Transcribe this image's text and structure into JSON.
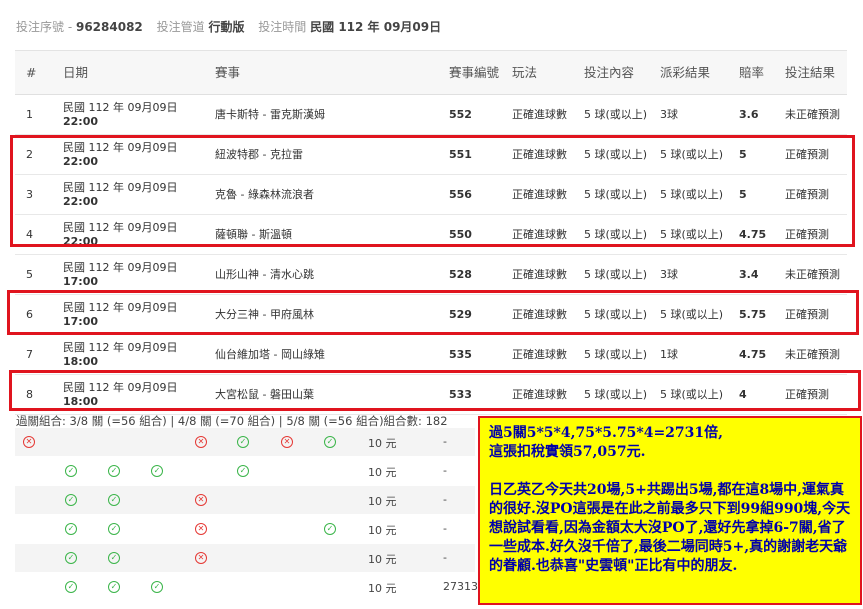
{
  "header": {
    "serial_label": "投注序號",
    "serial_value": "96284082",
    "channel_label": "投注管道",
    "channel_value": "行動版",
    "time_label": "投注時間",
    "time_value": "民國 112 年 09月09日"
  },
  "table": {
    "headers": [
      "#",
      "日期",
      "賽事",
      "賽事編號",
      "玩法",
      "投注內容",
      "派彩結果",
      "賠率",
      "投注結果"
    ],
    "rows": [
      {
        "n": "1",
        "date": "民國 112 年 09月09日",
        "time": "22:00",
        "match": "唐卡斯特 - 雷克斯漢姆",
        "id": "552",
        "play": "正確進球數",
        "bet": "5 球(或以上)",
        "payout": "3球",
        "odds": "3.6",
        "result": "未正確預測"
      },
      {
        "n": "2",
        "date": "民國 112 年 09月09日",
        "time": "22:00",
        "match": "紐波特郡 - 克拉雷",
        "id": "551",
        "play": "正確進球數",
        "bet": "5 球(或以上)",
        "payout": "5 球(或以上)",
        "odds": "5",
        "result": "正確預測"
      },
      {
        "n": "3",
        "date": "民國 112 年 09月09日",
        "time": "22:00",
        "match": "克魯 - 綠森林流浪者",
        "id": "556",
        "play": "正確進球數",
        "bet": "5 球(或以上)",
        "payout": "5 球(或以上)",
        "odds": "5",
        "result": "正確預測"
      },
      {
        "n": "4",
        "date": "民國 112 年 09月09日",
        "time": "22:00",
        "match": "薩頓聯 - 斯溫頓",
        "id": "550",
        "play": "正確進球數",
        "bet": "5 球(或以上)",
        "payout": "5 球(或以上)",
        "odds": "4.75",
        "result": "正確預測"
      },
      {
        "n": "5",
        "date": "民國 112 年 09月09日",
        "time": "17:00",
        "match": "山形山神 - 清水心跳",
        "id": "528",
        "play": "正確進球數",
        "bet": "5 球(或以上)",
        "payout": "3球",
        "odds": "3.4",
        "result": "未正確預測"
      },
      {
        "n": "6",
        "date": "民國 112 年 09月09日",
        "time": "17:00",
        "match": "大分三神 - 甲府風林",
        "id": "529",
        "play": "正確進球數",
        "bet": "5 球(或以上)",
        "payout": "5 球(或以上)",
        "odds": "5.75",
        "result": "正確預測"
      },
      {
        "n": "7",
        "date": "民國 112 年 09月09日",
        "time": "18:00",
        "match": "仙台維加塔 - 岡山綠雉",
        "id": "535",
        "play": "正確進球數",
        "bet": "5 球(或以上)",
        "payout": "1球",
        "odds": "4.75",
        "result": "未正確預測"
      },
      {
        "n": "8",
        "date": "民國 112 年 09月09日",
        "time": "18:00",
        "match": "大宮松鼠 - 磐田山葉",
        "id": "533",
        "play": "正確進球數",
        "bet": "5 球(或以上)",
        "payout": "5 球(或以上)",
        "odds": "4",
        "result": "正確預測"
      }
    ]
  },
  "summary": "過關組合: 3/8 關 (=56 組合) | 4/8 關 (=70 組合) | 5/8 關 (=56 組合)組合數: 182",
  "combos": [
    {
      "icons": [
        "no",
        "",
        "",
        "",
        "no",
        "ok",
        "no",
        "ok"
      ],
      "amount": "10 元",
      "payout": "-"
    },
    {
      "icons": [
        "",
        "ok",
        "ok",
        "ok",
        "",
        "ok",
        "",
        ""
      ],
      "amount": "10 元",
      "payout": "-"
    },
    {
      "icons": [
        "",
        "ok",
        "ok",
        "",
        "no",
        "",
        "",
        ""
      ],
      "amount": "10 元",
      "payout": "-"
    },
    {
      "icons": [
        "",
        "ok",
        "ok",
        "",
        "no",
        "",
        "",
        "ok"
      ],
      "amount": "10 元",
      "payout": "-"
    },
    {
      "icons": [
        "",
        "ok",
        "ok",
        "",
        "no",
        "",
        "",
        ""
      ],
      "amount": "10 元",
      "payout": "-"
    },
    {
      "icons": [
        "",
        "ok",
        "ok",
        "ok",
        "",
        "",
        "",
        ""
      ],
      "amount": "10 元",
      "payout": "27313"
    }
  ],
  "note": {
    "line1": "過5關5*5*4,75*5.75*4=2731倍,",
    "line2": "這張扣稅實領57,057元.",
    "para": "日乙英乙今天共20場,5+共踢出5場,都在這8場中,運氣真的很好.沒PO這張是在此之前最多只下到99組990塊,今天想說試看看,因為金額太大沒PO了,還好先拿掉6-7關,省了一些成本.好久沒千倍了,最後二場同時5+,真的謝謝老天爺的眷顧.也恭喜\"史雲頓\"正比有中的朋友."
  },
  "colors": {
    "highlight": "#e0141e",
    "note_bg": "#ffff00",
    "note_text": "#0000aa",
    "win": "#3bb54a",
    "lose": "#e53935"
  }
}
